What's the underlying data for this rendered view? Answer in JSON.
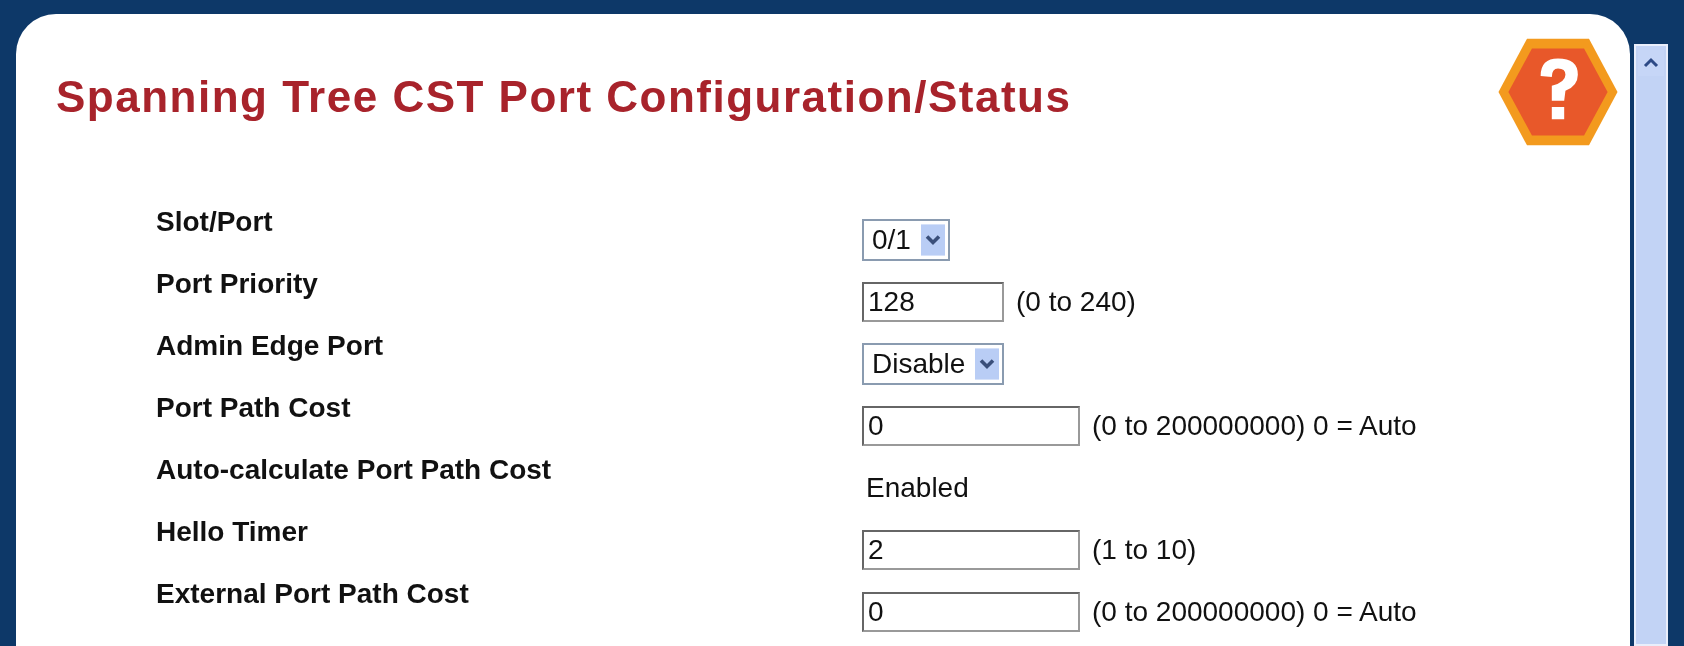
{
  "page": {
    "title": "Spanning Tree CST Port Configuration/Status"
  },
  "fields": [
    {
      "label": "Slot/Port",
      "kind": "select",
      "value": "0/1"
    },
    {
      "label": "Port Priority",
      "kind": "short",
      "value": "128",
      "hint": "(0 to 240)"
    },
    {
      "label": "Admin Edge Port",
      "kind": "select",
      "value": "Disable"
    },
    {
      "label": "Port Path Cost",
      "kind": "text",
      "value": "0",
      "hint": "(0 to 200000000) 0 = Auto"
    },
    {
      "label": "Auto-calculate Port Path Cost",
      "kind": "static",
      "value": "Enabled"
    },
    {
      "label": "Hello Timer",
      "kind": "text",
      "value": "2",
      "hint": "(1 to 10)"
    },
    {
      "label": "External Port Path Cost",
      "kind": "text",
      "value": "0",
      "hint": "(0 to 200000000) 0 = Auto"
    }
  ]
}
